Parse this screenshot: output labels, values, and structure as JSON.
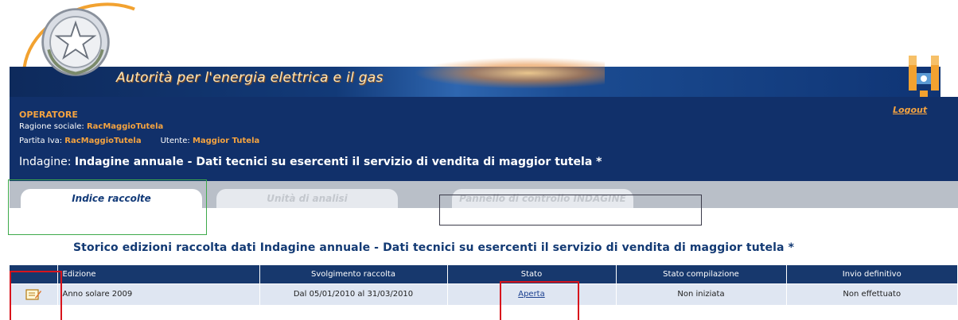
{
  "header": {
    "authority_name": "Autorità per l'energia elettrica e il gas",
    "emblem_icon": "italian-republic-emblem-icon",
    "plug_icon": "energy-plug-icon",
    "brand_navy": "#11306a",
    "brand_orange": "#f4a340"
  },
  "operator": {
    "label": "OPERATORE",
    "ragione_label": "Ragione sociale: ",
    "ragione_value": "RacMaggioTutela",
    "partita_label": "Partita Iva: ",
    "partita_value": "RacMaggioTutela",
    "utente_label": "Utente: ",
    "utente_value": "Maggior Tutela",
    "logout": "Logout",
    "indagine_label": "Indagine: ",
    "indagine_title": "Indagine annuale - Dati tecnici su esercenti il servizio di vendita di maggior tutela *"
  },
  "tabs": [
    {
      "label": "Indice raccolte",
      "active": true
    },
    {
      "label": "Unità di analisi",
      "active": false
    },
    {
      "label": "Pannello di controllo INDAGINE",
      "active": false
    }
  ],
  "history": {
    "title": "Storico edizioni raccolta dati Indagine annuale - Dati tecnici su esercenti il servizio di vendita di maggior tutela *"
  },
  "table": {
    "headers": [
      "",
      "Edizione",
      "Svolgimento raccolta",
      "Stato",
      "Stato compilazione",
      "Invio definitivo"
    ],
    "rows": [
      {
        "icon": "document-edit-icon",
        "edizione": "Anno solare 2009",
        "svolgimento": "Dal 05/01/2010 al 31/03/2010",
        "stato": "Aperta",
        "stato_compilazione": "Non iniziata",
        "invio_definitivo": "Non effettuato"
      }
    ]
  }
}
